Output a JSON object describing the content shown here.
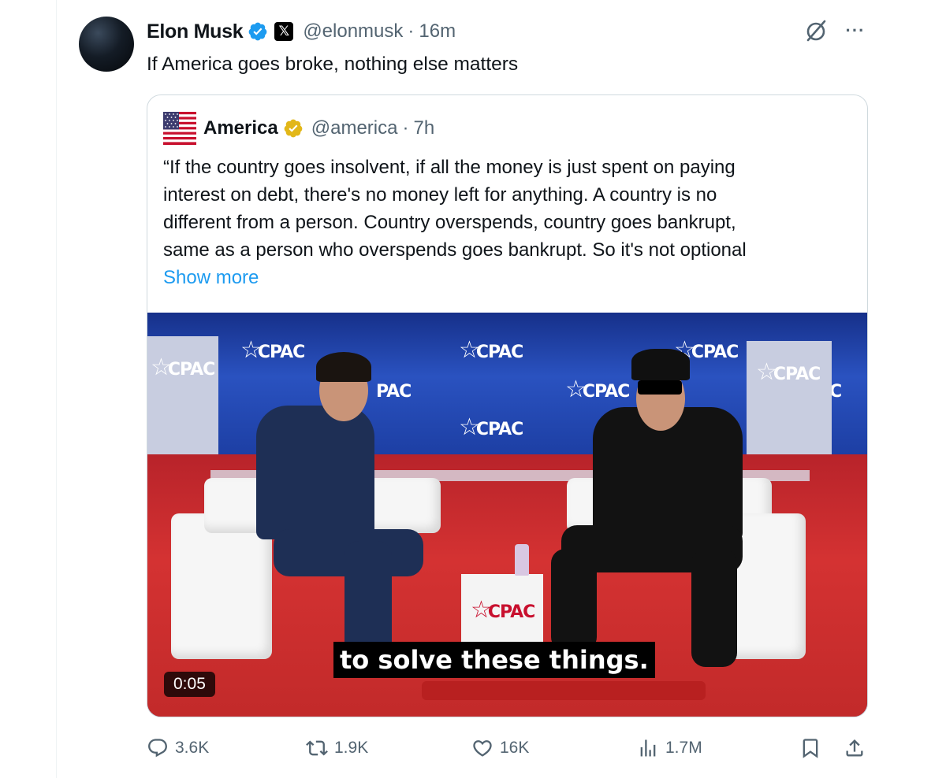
{
  "tweet": {
    "author_name": "Elon Musk",
    "author_handle": "@elonmusk",
    "separator": "·",
    "time": "16m",
    "text": "If America goes broke, nothing else matters"
  },
  "quote": {
    "author_name": "America",
    "author_handle": "@america",
    "separator": "·",
    "time": "7h",
    "lines": [
      "“If the country goes insolvent, if all the money is just spent on paying",
      "interest on debt, there's no money left for anything. A country is no",
      "different from a person. Country overspends, country goes bankrupt,",
      "same as a person who overspends goes bankrupt. So it's not optional"
    ],
    "show_more": "Show more",
    "media": {
      "subtitle": "to solve these things.",
      "duration": "0:05",
      "logo_text": "CPAC",
      "logo_fragments": [
        "PAC",
        "C"
      ]
    }
  },
  "actions": {
    "replies": "3.6K",
    "reposts": "1.9K",
    "likes": "16K",
    "views": "1.7M"
  },
  "colors": {
    "text": "#0f1419",
    "secondary": "#536471",
    "link": "#1d9bf0",
    "verified_blue": "#1d9bf0",
    "verified_gold": "#e2b719",
    "border": "#cfd9de"
  },
  "icons": [
    "verified-badge-icon",
    "x-logo-icon",
    "grok-icon",
    "more-icon",
    "us-flag-icon",
    "gold-verified-badge-icon",
    "reply-icon",
    "repost-icon",
    "like-icon",
    "views-icon",
    "bookmark-icon",
    "share-icon"
  ]
}
